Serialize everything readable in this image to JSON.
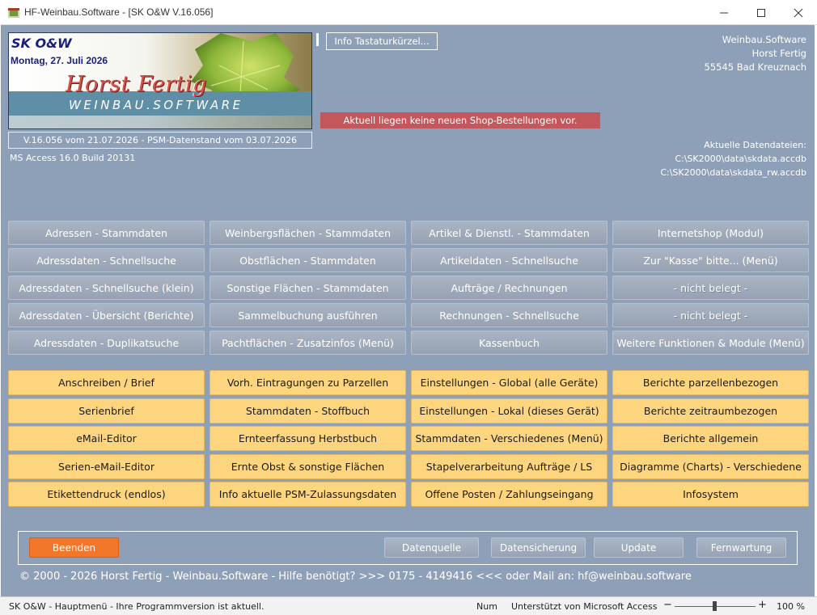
{
  "window": {
    "title": "HF-Weinbau.Software - [SK O&W V.16.056]"
  },
  "header": {
    "company": "SK O&W",
    "date": "Montag, 27. Juli 2026",
    "logo_name": "Horst Fertig",
    "logo_sub": "WEINBAU.SOFTWARE",
    "version": "V.16.056 vom 21.07.2026 - PSM-Datenstand vom 03.07.2026",
    "access_version": "MS Access 16.0 Build 20131",
    "info_button": "Info Tastaturkürzel...",
    "shop_message": "Aktuell liegen keine neuen Shop-Bestellungen vor.",
    "address": [
      "Weinbau.Software",
      "Horst Fertig",
      "55545 Bad Kreuznach"
    ],
    "files_label": "Aktuelle Datendateien:",
    "files": [
      "C:\\SK2000\\data\\skdata.accdb",
      "C:\\SK2000\\data\\skdata_rw.accdb"
    ]
  },
  "gray_buttons": [
    {
      "label": "Adressen - Stammdaten"
    },
    {
      "label": "Weinbergsflächen - Stammdaten"
    },
    {
      "label": "Artikel & Dienstl. - Stammdaten"
    },
    {
      "label": "Internetshop (Modul)"
    },
    {
      "label": "Adressdaten - Schnellsuche"
    },
    {
      "label": "Obstflächen - Stammdaten"
    },
    {
      "label": "Artikeldaten - Schnellsuche"
    },
    {
      "label": "Zur \"Kasse\" bitte... (Menü)"
    },
    {
      "label": "Adressdaten - Schnellsuche (klein)"
    },
    {
      "label": "Sonstige Flächen - Stammdaten"
    },
    {
      "label": "Aufträge / Rechnungen"
    },
    {
      "label": "- nicht belegt -"
    },
    {
      "label": "Adressdaten - Übersicht (Berichte)"
    },
    {
      "label": "Sammelbuchung ausführen"
    },
    {
      "label": "Rechnungen - Schnellsuche"
    },
    {
      "label": "- nicht belegt -"
    },
    {
      "label": "Adressdaten - Duplikatsuche"
    },
    {
      "label": "Pachtflächen - Zusatzinfos (Menü)"
    },
    {
      "label": "Kassenbuch"
    },
    {
      "label": "Weitere Funktionen & Module (Menü)"
    }
  ],
  "yellow_buttons": [
    {
      "label": "Anschreiben / Brief"
    },
    {
      "label": "Vorh. Eintragungen zu Parzellen"
    },
    {
      "label": "Einstellungen - Global (alle Geräte)"
    },
    {
      "label": "Berichte parzellenbezogen"
    },
    {
      "label": "Serienbrief"
    },
    {
      "label": "Stammdaten - Stoffbuch"
    },
    {
      "label": "Einstellungen - Lokal (dieses Gerät)"
    },
    {
      "label": "Berichte zeitraumbezogen"
    },
    {
      "label": "eMail-Editor"
    },
    {
      "label": "Ernteerfassung Herbstbuch"
    },
    {
      "label": "Stammdaten - Verschiedenes (Menü)"
    },
    {
      "label": "Berichte allgemein"
    },
    {
      "label": "Serien-eMail-Editor"
    },
    {
      "label": "Ernte Obst & sonstige Flächen"
    },
    {
      "label": "Stapelverarbeitung Aufträge / LS"
    },
    {
      "label": "Diagramme (Charts) - Verschiedene"
    },
    {
      "label": "Etikettendruck (endlos)"
    },
    {
      "label": "Info aktuelle PSM-Zulassungsdaten"
    },
    {
      "label": "Offene Posten / Zahlungseingang"
    },
    {
      "label": "Infosystem"
    }
  ],
  "bottom": {
    "quit": "Beenden",
    "datasource": "Datenquelle",
    "backup": "Datensicherung",
    "update": "Update",
    "remote": "Fernwartung",
    "footer": "© 2000 - 2026 Horst Fertig - Weinbau.Software - Hilfe benötigt? >>> 0175 - 4149416 <<< oder Mail an: hf@weinbau.software"
  },
  "statusbar": {
    "left": "SK O&W - Hauptmenü - Ihre Programmversion ist aktuell.",
    "num": "Num",
    "ms": "Unterstützt von Microsoft Access",
    "minus": "−",
    "plus": "+",
    "zoom": "100 %"
  }
}
